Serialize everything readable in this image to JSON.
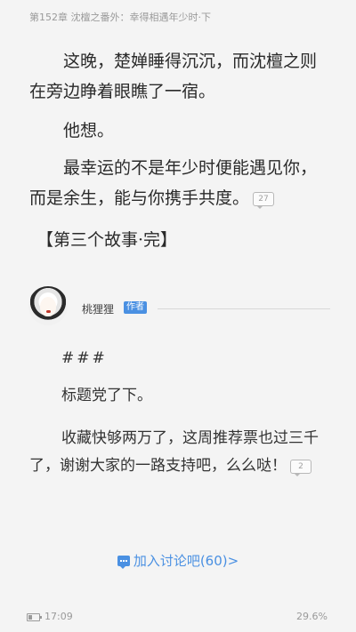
{
  "chapter": {
    "title": "第152章 沈檀之番外：幸得相遇年少时·下"
  },
  "story": {
    "p1": "这晚，楚婵睡得沉沉，而沈檀之则在旁边睁着眼瞧了一宿。",
    "p2": "他想。",
    "p3": "最幸运的不是年少时便能遇见你，而是余生，能与你携手共度。",
    "p3_comments": "27",
    "p4": "【第三个故事·完】"
  },
  "author_note": {
    "name": "桃狸狸",
    "badge": "作者",
    "lines": [
      "###",
      "标题党了下。",
      "收藏快够两万了，这周推荐票也过三千了，谢谢大家的一路支持吧，么么哒！"
    ],
    "comments": "2"
  },
  "discussion": {
    "label": "加入讨论吧(60)>"
  },
  "status_bar": {
    "time": "17:09",
    "progress": "29.6%",
    "battery_level": 0.3
  }
}
